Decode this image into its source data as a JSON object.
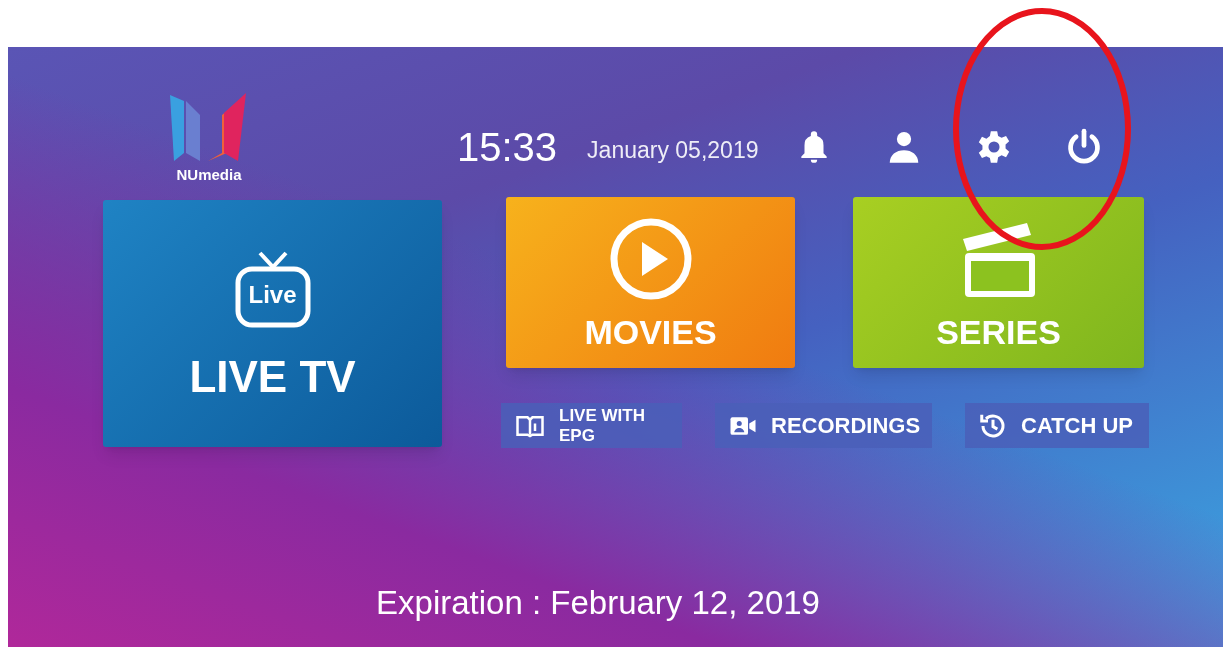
{
  "logo": {
    "text": "NUmedia"
  },
  "header": {
    "time": "15:33",
    "date": "January 05,2019",
    "icons": [
      {
        "kind": "bell"
      },
      {
        "kind": "user"
      },
      {
        "kind": "gear"
      },
      {
        "kind": "power"
      }
    ]
  },
  "tiles": [
    {
      "kind": "tv",
      "label": "LIVE TV",
      "badge": "Live"
    },
    {
      "kind": "play",
      "label": "MOVIES"
    },
    {
      "kind": "clapper",
      "label": "SERIES"
    }
  ],
  "buttons": [
    {
      "kind": "book",
      "label": "LIVE WITH EPG"
    },
    {
      "kind": "camera",
      "label": "RECORDINGS"
    },
    {
      "kind": "clock",
      "label": "CATCH UP"
    }
  ],
  "expiration": "Expiration : February 12, 2019",
  "annotation": {
    "kind": "ellipse",
    "color": "#e8141c"
  }
}
